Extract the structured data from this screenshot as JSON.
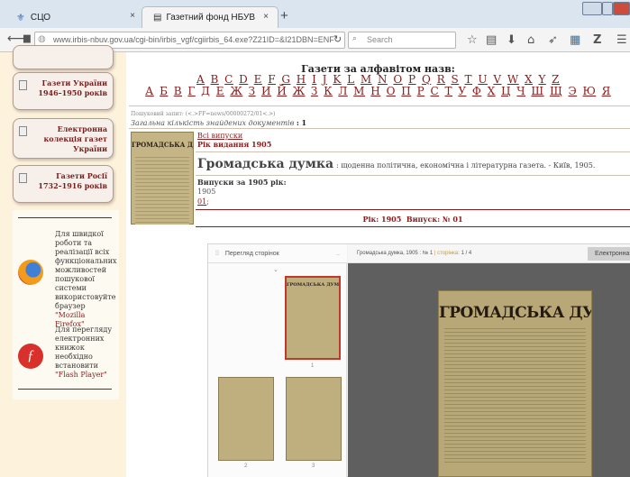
{
  "browser": {
    "tabs": [
      {
        "label": "СЦО"
      },
      {
        "label": "Газетний фонд НБУВ"
      }
    ],
    "new_tab": "+",
    "url": "www.irbis-nbuv.gov.ua/cgi-bin/irbis_vgf/cgiirbis_64.exe?Z21ID=&I21DBN=ENF",
    "search_placeholder": "Search"
  },
  "sidebar": {
    "cards": [
      {
        "label": "Газети України 1946–1950 років"
      },
      {
        "label": "Електронна колекція газет України"
      },
      {
        "label": "Газети Росії 1732–1916 років"
      }
    ],
    "firefox_text": "Для швидкої роботи та реалізації всіх функціональних можливостей пошукової системи використовуйте браузер",
    "firefox_link": "\"Mozilla Firefox\"",
    "flash_text": "Для перегляду електронних книжок необхідно встановити",
    "flash_link": "\"Flash Player\""
  },
  "main": {
    "heading": "Газети за алфавітом назв:",
    "latin_letters": [
      "A",
      "B",
      "C",
      "D",
      "E",
      "F",
      "G",
      "H",
      "I",
      "J",
      "K",
      "L",
      "M",
      "N",
      "O",
      "P",
      "Q",
      "R",
      "S",
      "T",
      "U",
      "V",
      "W",
      "X",
      "Y",
      "Z"
    ],
    "cyrillic_letters": [
      "А",
      "Б",
      "В",
      "Г",
      "Д",
      "Е",
      "Ж",
      "З",
      "И",
      "Й",
      "Ж",
      "З",
      "К",
      "Л",
      "М",
      "Н",
      "О",
      "П",
      "Р",
      "С",
      "Т",
      "У",
      "Ф",
      "Х",
      "Ц",
      "Ч",
      "Ш",
      "Щ",
      "Э",
      "Ю",
      "Я"
    ],
    "query": "Пошуковий запит: (<.>FF=news/00000272/01<.>)",
    "total_label": "Загальна кількість знайдених документів",
    "total_value": ": 1",
    "all_issues": "Всі випуски",
    "year_label": "Рік видання 1905",
    "paper_name": "Громадська думка",
    "paper_desc": ": щоденна політична, економічна і літературна газета. - Київ, 1905.",
    "issues_heading": "Випуски за 1905 рік:",
    "issue_year": "1905",
    "issue_num": "01",
    "issue_sep": ";",
    "summary": "Рік: 1905  Випуск: № 01"
  },
  "viewer": {
    "thumbs_title": "Перегляд сторінок",
    "doc_title": "Громадська думка, 1905 : № 1",
    "page_label": "сторінка:",
    "page_value": "1 / 4",
    "electronic_button": "Електронна",
    "thumb_numbers": [
      "1",
      "2",
      "3"
    ],
    "masthead": "ГРОМАДСЬКА ДУМКА"
  }
}
